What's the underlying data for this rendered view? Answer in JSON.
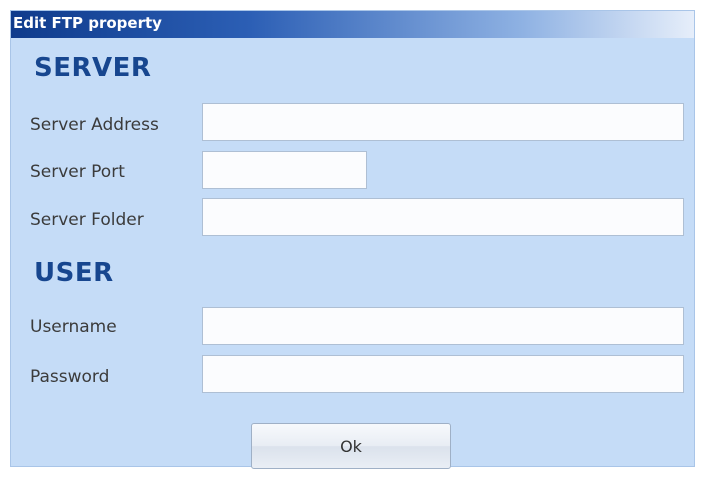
{
  "window": {
    "title": "Edit FTP property"
  },
  "server": {
    "heading": "SERVER",
    "address_label": "Server Address",
    "address_value": "",
    "port_label": "Server Port",
    "port_value": "",
    "folder_label": "Server Folder",
    "folder_value": ""
  },
  "user": {
    "heading": "USER",
    "username_label": "Username",
    "username_value": "",
    "password_label": "Password",
    "password_value": ""
  },
  "actions": {
    "ok_label": "Ok"
  },
  "colors": {
    "window_background": "#c5dcf7",
    "heading": "#17468f",
    "titlebar_start": "#0f3b8c"
  }
}
